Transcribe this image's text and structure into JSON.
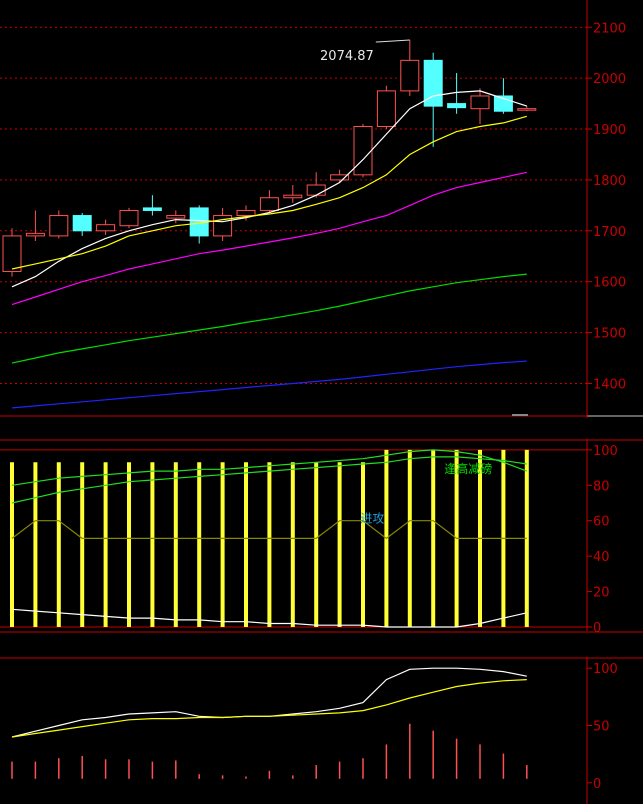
{
  "theme": {
    "background": "#000000",
    "axis": "#c80000",
    "grid": "#c80000",
    "tick_text": "#c80000",
    "up": "#ff5050",
    "down": "#54ffff",
    "osc_bar": "#ffff33",
    "annotation_text": "#1e9fd8",
    "highlight_text": "#00e000"
  },
  "chart_data": [
    {
      "type": "candlestick",
      "panel": "price",
      "ylim": [
        1340,
        2130
      ],
      "yticks": [
        1400,
        1500,
        1600,
        1700,
        1800,
        1900,
        2000,
        2100
      ],
      "grid": true,
      "peak_label": "2074.87",
      "candles": [
        {
          "o": 1620,
          "h": 1705,
          "l": 1610,
          "c": 1690
        },
        {
          "o": 1690,
          "h": 1740,
          "l": 1680,
          "c": 1695
        },
        {
          "o": 1690,
          "h": 1740,
          "l": 1685,
          "c": 1730
        },
        {
          "o": 1730,
          "h": 1735,
          "l": 1690,
          "c": 1700
        },
        {
          "o": 1700,
          "h": 1722,
          "l": 1692,
          "c": 1712
        },
        {
          "o": 1710,
          "h": 1745,
          "l": 1705,
          "c": 1740
        },
        {
          "o": 1745,
          "h": 1770,
          "l": 1730,
          "c": 1740
        },
        {
          "o": 1725,
          "h": 1740,
          "l": 1715,
          "c": 1730
        },
        {
          "o": 1745,
          "h": 1750,
          "l": 1675,
          "c": 1690
        },
        {
          "o": 1690,
          "h": 1745,
          "l": 1680,
          "c": 1730
        },
        {
          "o": 1730,
          "h": 1750,
          "l": 1720,
          "c": 1740
        },
        {
          "o": 1740,
          "h": 1780,
          "l": 1735,
          "c": 1765
        },
        {
          "o": 1765,
          "h": 1790,
          "l": 1755,
          "c": 1770
        },
        {
          "o": 1770,
          "h": 1815,
          "l": 1765,
          "c": 1790
        },
        {
          "o": 1800,
          "h": 1820,
          "l": 1795,
          "c": 1810
        },
        {
          "o": 1810,
          "h": 1910,
          "l": 1805,
          "c": 1905
        },
        {
          "o": 1905,
          "h": 1985,
          "l": 1900,
          "c": 1975
        },
        {
          "o": 1975,
          "h": 2074.87,
          "l": 1965,
          "c": 2035
        },
        {
          "o": 2035,
          "h": 2050,
          "l": 1865,
          "c": 1945
        },
        {
          "o": 1950,
          "h": 2010,
          "l": 1930,
          "c": 1942
        },
        {
          "o": 1940,
          "h": 1980,
          "l": 1910,
          "c": 1965
        },
        {
          "o": 1965,
          "h": 2000,
          "l": 1930,
          "c": 1935
        },
        {
          "o": 1940,
          "h": 1945,
          "l": 1935,
          "c": 1940
        }
      ],
      "series": [
        {
          "color": "#ffffff",
          "values": [
            1590,
            1610,
            1640,
            1665,
            1685,
            1700,
            1712,
            1722,
            1720,
            1718,
            1726,
            1736,
            1750,
            1770,
            1795,
            1840,
            1890,
            1940,
            1965,
            1972,
            1975,
            1960,
            1945
          ]
        },
        {
          "color": "#ffff00",
          "values": [
            1625,
            1635,
            1645,
            1655,
            1670,
            1690,
            1700,
            1710,
            1715,
            1722,
            1728,
            1733,
            1740,
            1752,
            1765,
            1785,
            1810,
            1850,
            1875,
            1895,
            1905,
            1912,
            1925
          ]
        },
        {
          "color": "#ff00ff",
          "values": [
            1555,
            1570,
            1585,
            1600,
            1612,
            1625,
            1635,
            1645,
            1655,
            1662,
            1670,
            1678,
            1686,
            1695,
            1705,
            1718,
            1730,
            1750,
            1770,
            1785,
            1795,
            1805,
            1815
          ]
        },
        {
          "color": "#00dd00",
          "values": [
            1440,
            1450,
            1460,
            1468,
            1476,
            1484,
            1491,
            1498,
            1505,
            1512,
            1520,
            1527,
            1535,
            1543,
            1552,
            1562,
            1572,
            1582,
            1590,
            1598,
            1604,
            1610,
            1615
          ]
        },
        {
          "color": "#2222ff",
          "values": [
            1352,
            1356,
            1360,
            1364,
            1368,
            1372,
            1376,
            1380,
            1384,
            1388,
            1392,
            1396,
            1400,
            1404,
            1408,
            1413,
            1418,
            1423,
            1428,
            1433,
            1437,
            1441,
            1444
          ]
        }
      ]
    },
    {
      "type": "bar",
      "panel": "indicator",
      "ylim": [
        0,
        105
      ],
      "yticks": [
        0,
        20,
        40,
        60,
        80,
        100
      ],
      "grid": false,
      "bar_values": [
        93,
        93,
        93,
        93,
        93,
        93,
        93,
        93,
        93,
        93,
        93,
        93,
        93,
        93,
        93,
        93,
        100,
        100,
        100,
        100,
        100,
        100,
        100
      ],
      "annotations": [
        {
          "text": "逢高减磅",
          "x_index": 19.5,
          "y": 87,
          "highlight": true
        },
        {
          "text": "进攻",
          "x_index": 15.4,
          "y": 59,
          "highlight": false
        }
      ],
      "series": [
        {
          "color": "#ffffff",
          "values": [
            10,
            9,
            8,
            7,
            6,
            5,
            5,
            4,
            4,
            3,
            3,
            2,
            2,
            1,
            1,
            1,
            0,
            0,
            0,
            0,
            2,
            5,
            8
          ]
        },
        {
          "color": "#22dd22",
          "values": [
            80,
            82,
            84,
            85,
            86,
            87,
            88,
            88,
            89,
            89,
            90,
            91,
            92,
            93,
            94,
            95,
            97,
            99,
            100,
            99,
            97,
            93,
            88
          ]
        },
        {
          "color": "#22dd22",
          "values": [
            70,
            73,
            76,
            78,
            80,
            82,
            83,
            84,
            85,
            86,
            87,
            88,
            89,
            90,
            91,
            92,
            93,
            95,
            96,
            96,
            95,
            94,
            92
          ]
        },
        {
          "color": "#888800",
          "values": [
            50,
            60,
            60,
            50,
            50,
            50,
            50,
            50,
            50,
            50,
            50,
            50,
            50,
            50,
            60,
            60,
            50,
            60,
            60,
            50,
            50,
            50,
            50
          ]
        }
      ]
    },
    {
      "type": "line",
      "panel": "oscillator",
      "ylim": [
        -15,
        108
      ],
      "yticks": [
        0,
        50,
        100
      ],
      "grid": false,
      "bar_values": [
        15,
        15,
        18,
        20,
        17,
        17,
        15,
        16,
        4,
        3,
        2,
        7,
        3,
        12,
        15,
        18,
        30,
        48,
        42,
        35,
        30,
        22,
        12
      ],
      "series": [
        {
          "color": "#ffffff",
          "values": [
            40,
            45,
            50,
            55,
            57,
            60,
            61,
            62,
            58,
            57,
            58,
            58,
            60,
            62,
            65,
            70,
            90,
            99,
            100,
            100,
            99,
            97,
            93
          ]
        },
        {
          "color": "#ffff00",
          "values": [
            40,
            43,
            46,
            49,
            52,
            55,
            56,
            56,
            57,
            57,
            58,
            58,
            59,
            60,
            61,
            63,
            68,
            74,
            79,
            84,
            87,
            89,
            90
          ]
        }
      ]
    }
  ]
}
